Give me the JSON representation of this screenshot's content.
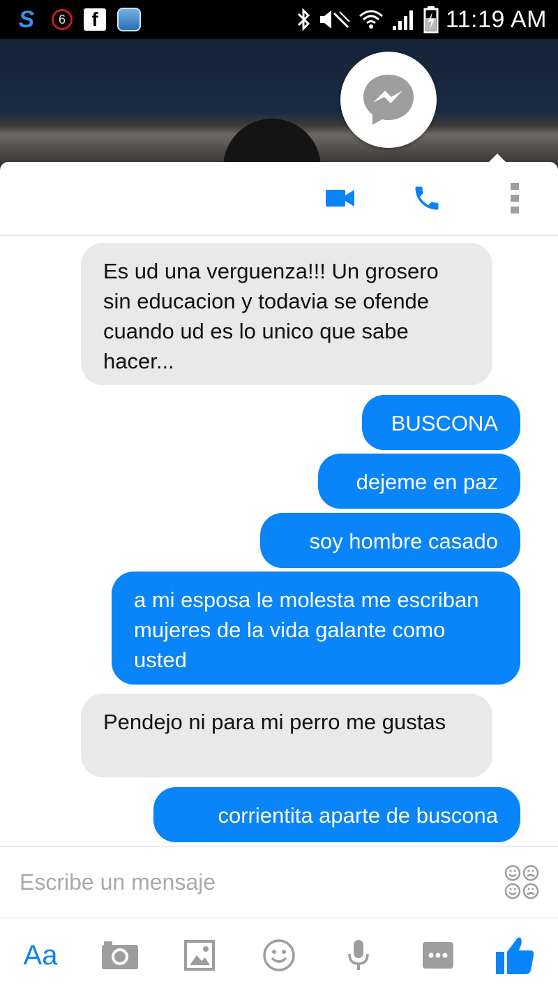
{
  "status_bar": {
    "notification_count": "6",
    "facebook_glyph": "f",
    "app_logo_glyph": "S",
    "time": "11:19 AM",
    "icons": [
      "s-app-icon",
      "notification-count-icon",
      "facebook-icon",
      "app-icon",
      "bluetooth-icon",
      "mute-icon",
      "wifi-icon",
      "signal-icon",
      "battery-charging-icon"
    ]
  },
  "header": {
    "chat_head_icon": "messenger-icon",
    "actions": [
      {
        "name": "video-call",
        "icon": "video-camera-icon"
      },
      {
        "name": "voice-call",
        "icon": "phone-icon"
      },
      {
        "name": "more-options",
        "icon": "vertical-dots-icon"
      }
    ]
  },
  "messages": [
    {
      "direction": "incoming",
      "text": "Es ud una verguenza!!! Un grosero sin educacion y todavia se ofende cuando ud es lo unico que sabe hacer..."
    },
    {
      "direction": "outgoing",
      "text": "BUSCONA"
    },
    {
      "direction": "outgoing",
      "text": "dejeme en paz"
    },
    {
      "direction": "outgoing",
      "text": "soy hombre casado"
    },
    {
      "direction": "outgoing",
      "text": "a mi esposa le molesta me escriban mujeres de la vida galante como usted"
    },
    {
      "direction": "incoming",
      "text": "Pendejo ni para mi perro me gustas"
    },
    {
      "direction": "outgoing",
      "text": "corrientita aparte de buscona"
    }
  ],
  "composer": {
    "placeholder": "Escribe un mensaje",
    "sticker_icon": "sticker-faces-icon"
  },
  "bottom_bar": {
    "text_label": "Aa",
    "items": [
      "text-format-icon",
      "camera-icon",
      "gallery-icon",
      "emoji-icon",
      "microphone-icon",
      "more-icon",
      "thumbs-up-icon"
    ]
  },
  "colors": {
    "accent": "#0a84f9",
    "incoming_bubble": "#e9e9e9",
    "status_bar": "#000000",
    "icon_gray": "#9e9e9e"
  }
}
